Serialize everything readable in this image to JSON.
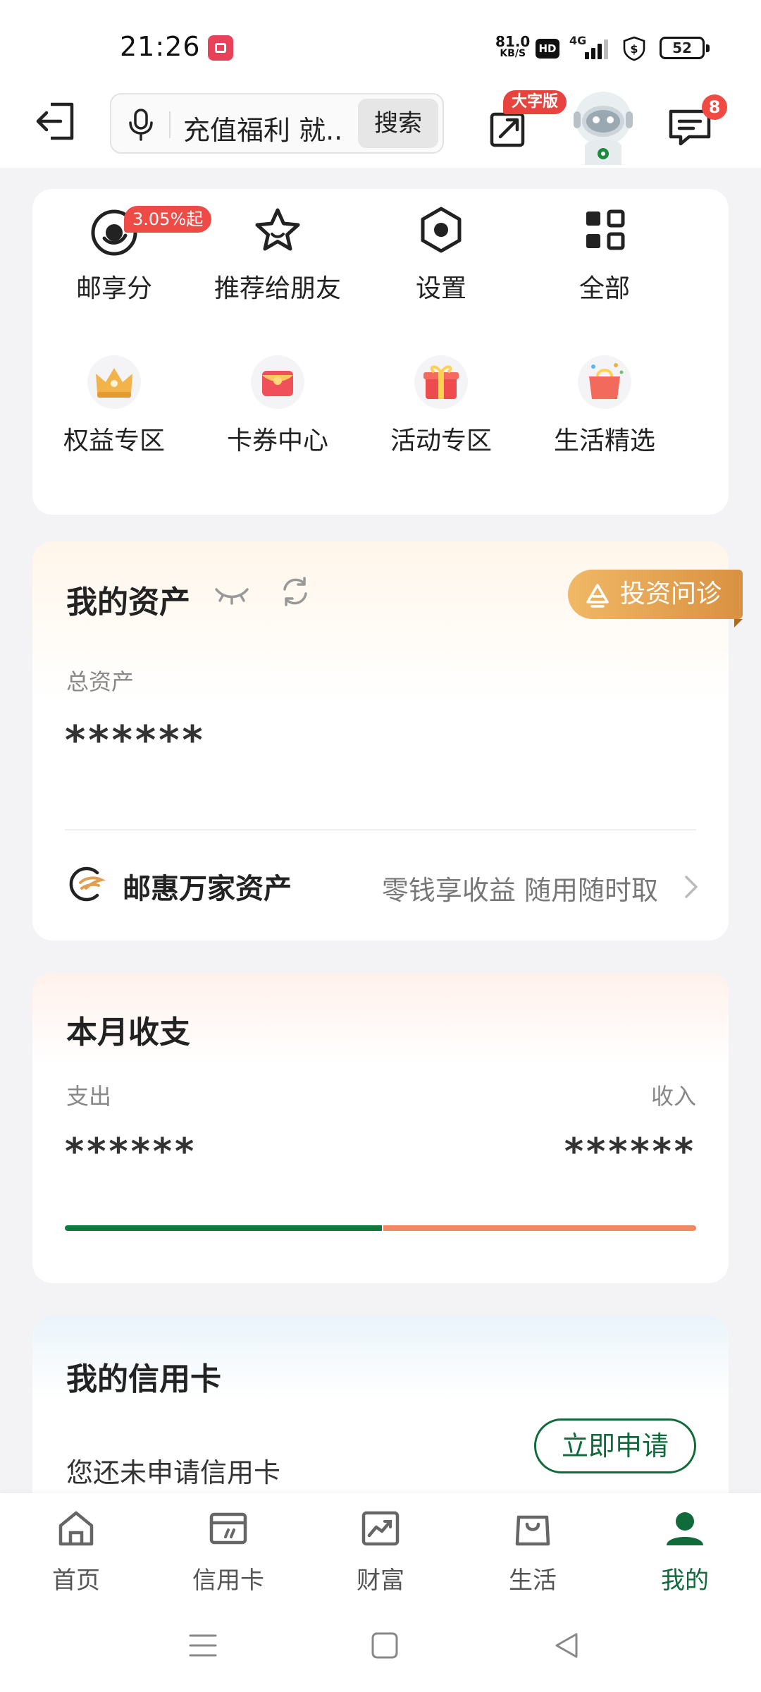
{
  "status_bar": {
    "time": "21:26",
    "net_speed_value": "81.0",
    "net_speed_unit": "KB/S",
    "hd_label": "HD",
    "signal_label": "4G",
    "battery": "52"
  },
  "header": {
    "search_text": "充值福利 就...",
    "search_button": "搜索",
    "big_font_badge": "大字版",
    "message_count": "8"
  },
  "quick_menu": {
    "rate_badge": "3.05%起",
    "items": [
      {
        "label": "邮享分",
        "icon": "youxiangfen-icon"
      },
      {
        "label": "推荐给朋友",
        "icon": "star-icon"
      },
      {
        "label": "设置",
        "icon": "settings-hexagon-icon"
      },
      {
        "label": "全部",
        "icon": "grid-icon"
      },
      {
        "label": "权益专区",
        "icon": "crown-icon"
      },
      {
        "label": "卡券中心",
        "icon": "coupon-icon"
      },
      {
        "label": "活动专区",
        "icon": "gift-icon"
      },
      {
        "label": "生活精选",
        "icon": "shopping-bag-icon"
      }
    ]
  },
  "assets": {
    "title": "我的资产",
    "invest_button": "投资问诊",
    "total_label": "总资产",
    "total_value": "******",
    "youhui_title": "邮惠万家资产",
    "youhui_desc": "零钱享收益 随用随时取"
  },
  "monthly": {
    "title": "本月收支",
    "expense_label": "支出",
    "income_label": "收入",
    "expense_value": "******",
    "income_value": "******",
    "expense_color": "#0f7a3c",
    "income_color": "#ef8960"
  },
  "credit": {
    "title": "我的信用卡",
    "desc": "您还未申请信用卡",
    "apply_button": "立即申请"
  },
  "tabs": [
    {
      "label": "首页",
      "icon": "home-icon"
    },
    {
      "label": "信用卡",
      "icon": "credit-card-icon"
    },
    {
      "label": "财富",
      "icon": "wealth-chart-icon"
    },
    {
      "label": "生活",
      "icon": "shopping-bag-icon"
    },
    {
      "label": "我的",
      "icon": "person-icon",
      "active": true
    }
  ],
  "colors": {
    "brand_green": "#0f6b3a",
    "badge_red": "#ee4b46",
    "invest_gold": "#e0a052"
  }
}
